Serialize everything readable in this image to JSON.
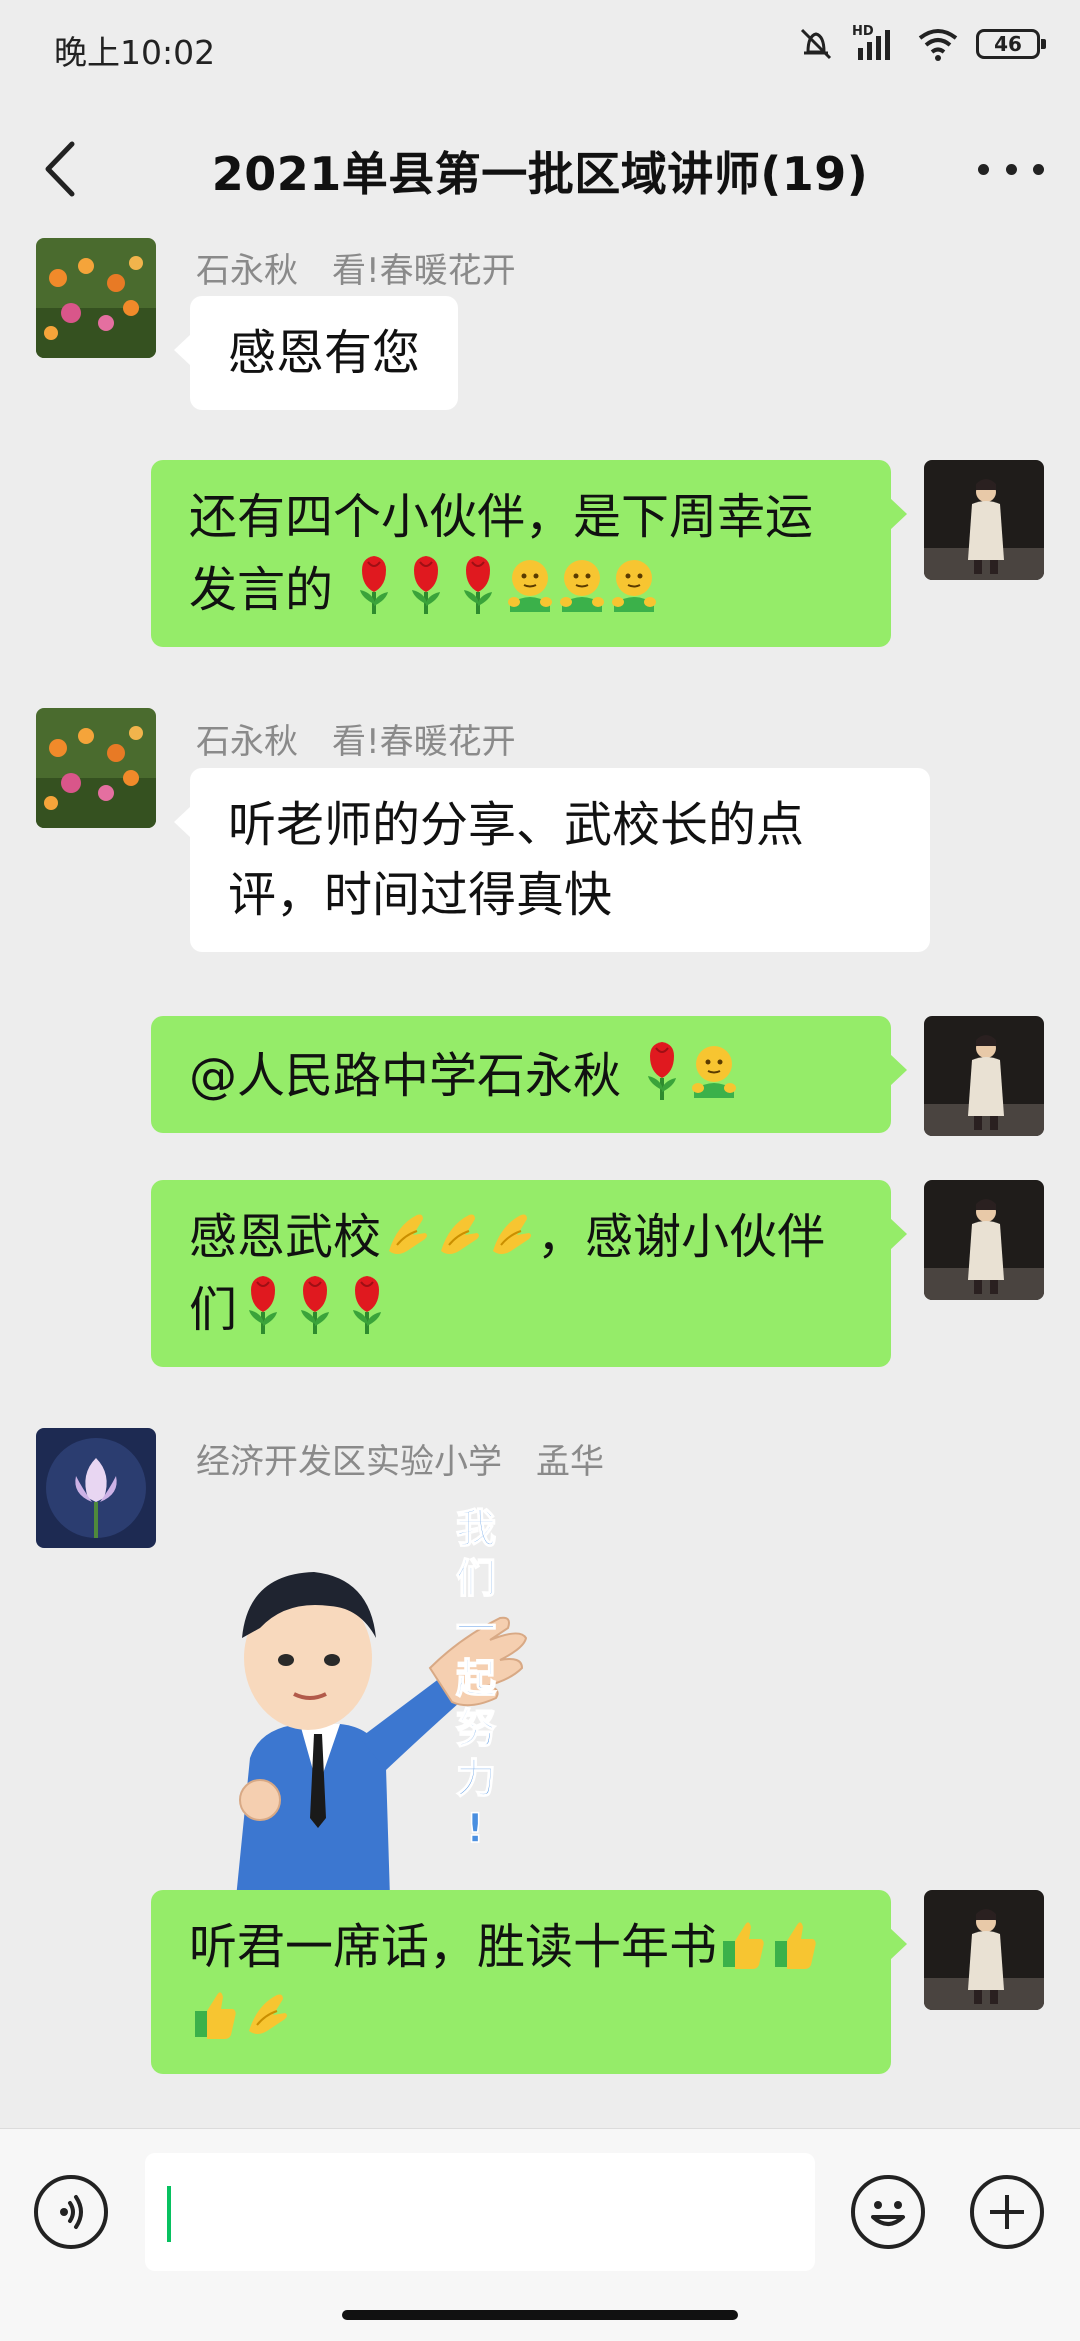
{
  "status_bar": {
    "time": "晚上10:02",
    "network_label": "HD",
    "battery": "46"
  },
  "header": {
    "title": "2021单县第一批区域讲师(19)"
  },
  "messages": [
    {
      "side": "left",
      "sender": "石永秋　看!春暖花开",
      "text": "感恩有您"
    },
    {
      "side": "right",
      "text": "还有四个小伙伴，是下周幸运发言的",
      "emojis": [
        "rose",
        "rose",
        "rose",
        "smiley-thumb",
        "smiley-thumb",
        "smiley-thumb"
      ]
    },
    {
      "side": "left",
      "sender": "石永秋　看!春暖花开",
      "text": "听老师的分享、武校长的点评，时间过得真快"
    },
    {
      "side": "right",
      "text": "@人民路中学石永秋 ",
      "emojis": [
        "rose",
        "smiley-thumb"
      ]
    },
    {
      "side": "right",
      "text_a": "感恩武校",
      "text_b": "，感谢小伙伴们",
      "emojis_a": [
        "ok-hand",
        "ok-hand",
        "ok-hand"
      ],
      "emojis_b": [
        "rose",
        "rose",
        "rose"
      ]
    },
    {
      "side": "left",
      "sender": "经济开发区实验小学　孟华",
      "sticker_text": "我们一起努力!"
    },
    {
      "side": "right",
      "text": "听君一席话，胜读十年书",
      "emojis": [
        "thumbs-up",
        "thumbs-up",
        "thumbs-up",
        "ok-hand"
      ]
    }
  ],
  "colors": {
    "bubble_right": "#95ec69",
    "bubble_left": "#ffffff",
    "background": "#ededed",
    "caret": "#07c160"
  }
}
